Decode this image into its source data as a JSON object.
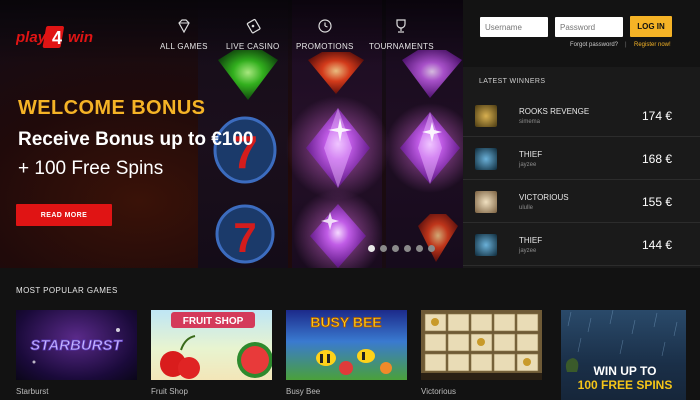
{
  "brand": {
    "name": "play4win"
  },
  "nav": [
    {
      "label": "ALL GAMES",
      "icon": "diamond-icon"
    },
    {
      "label": "LIVE CASINO",
      "icon": "cards-icon"
    },
    {
      "label": "PROMOTIONS",
      "icon": "clock-icon"
    },
    {
      "label": "TOURNAMENTS",
      "icon": "trophy-icon"
    }
  ],
  "hero": {
    "welcome": "WELCOME BONUS",
    "line1": "Receive Bonus up to €100",
    "line2": "+ 100 Free Spins",
    "cta": "READ MORE",
    "active_slide": 1,
    "slide_count": 6
  },
  "login": {
    "username_placeholder": "Username",
    "password_placeholder": "Password",
    "button": "LOG IN",
    "forgot": "Forgot password?",
    "separator": "|",
    "register": "Register now!"
  },
  "latest_winners": {
    "title": "LATEST WINNERS",
    "items": [
      {
        "game": "ROOKS REVENGE",
        "user": "simema",
        "amount": "174 €"
      },
      {
        "game": "THIEF",
        "user": "jayzee",
        "amount": "168 €"
      },
      {
        "game": "VICTORIOUS",
        "user": "ululle",
        "amount": "155 €"
      },
      {
        "game": "THIEF",
        "user": "jayzee",
        "amount": "144 €"
      }
    ]
  },
  "popular": {
    "title": "MOST POPULAR GAMES",
    "games": [
      {
        "name": "Starburst",
        "banner": "STARBURST"
      },
      {
        "name": "Fruit Shop",
        "banner": "FRUIT SHOP"
      },
      {
        "name": "Busy Bee",
        "banner": "BUSY BEE"
      },
      {
        "name": "Victorious",
        "banner": ""
      }
    ]
  },
  "promo": {
    "line1": "WIN UP TO",
    "line2": "100 FREE SPINS"
  },
  "colors": {
    "accent": "#f5b326",
    "cta": "#e01414",
    "panel": "#1a1a1a",
    "background": "#121212"
  }
}
